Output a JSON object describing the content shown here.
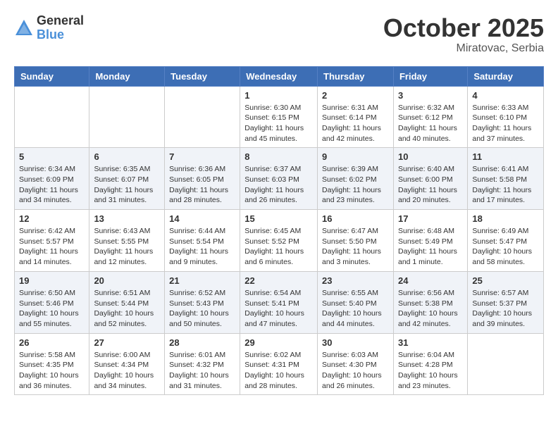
{
  "header": {
    "logo": {
      "general": "General",
      "blue": "Blue"
    },
    "title": "October 2025",
    "location": "Miratovac, Serbia"
  },
  "weekdays": [
    "Sunday",
    "Monday",
    "Tuesday",
    "Wednesday",
    "Thursday",
    "Friday",
    "Saturday"
  ],
  "weeks": [
    [
      {
        "day": "",
        "info": ""
      },
      {
        "day": "",
        "info": ""
      },
      {
        "day": "",
        "info": ""
      },
      {
        "day": "1",
        "info": "Sunrise: 6:30 AM\nSunset: 6:15 PM\nDaylight: 11 hours\nand 45 minutes."
      },
      {
        "day": "2",
        "info": "Sunrise: 6:31 AM\nSunset: 6:14 PM\nDaylight: 11 hours\nand 42 minutes."
      },
      {
        "day": "3",
        "info": "Sunrise: 6:32 AM\nSunset: 6:12 PM\nDaylight: 11 hours\nand 40 minutes."
      },
      {
        "day": "4",
        "info": "Sunrise: 6:33 AM\nSunset: 6:10 PM\nDaylight: 11 hours\nand 37 minutes."
      }
    ],
    [
      {
        "day": "5",
        "info": "Sunrise: 6:34 AM\nSunset: 6:09 PM\nDaylight: 11 hours\nand 34 minutes."
      },
      {
        "day": "6",
        "info": "Sunrise: 6:35 AM\nSunset: 6:07 PM\nDaylight: 11 hours\nand 31 minutes."
      },
      {
        "day": "7",
        "info": "Sunrise: 6:36 AM\nSunset: 6:05 PM\nDaylight: 11 hours\nand 28 minutes."
      },
      {
        "day": "8",
        "info": "Sunrise: 6:37 AM\nSunset: 6:03 PM\nDaylight: 11 hours\nand 26 minutes."
      },
      {
        "day": "9",
        "info": "Sunrise: 6:39 AM\nSunset: 6:02 PM\nDaylight: 11 hours\nand 23 minutes."
      },
      {
        "day": "10",
        "info": "Sunrise: 6:40 AM\nSunset: 6:00 PM\nDaylight: 11 hours\nand 20 minutes."
      },
      {
        "day": "11",
        "info": "Sunrise: 6:41 AM\nSunset: 5:58 PM\nDaylight: 11 hours\nand 17 minutes."
      }
    ],
    [
      {
        "day": "12",
        "info": "Sunrise: 6:42 AM\nSunset: 5:57 PM\nDaylight: 11 hours\nand 14 minutes."
      },
      {
        "day": "13",
        "info": "Sunrise: 6:43 AM\nSunset: 5:55 PM\nDaylight: 11 hours\nand 12 minutes."
      },
      {
        "day": "14",
        "info": "Sunrise: 6:44 AM\nSunset: 5:54 PM\nDaylight: 11 hours\nand 9 minutes."
      },
      {
        "day": "15",
        "info": "Sunrise: 6:45 AM\nSunset: 5:52 PM\nDaylight: 11 hours\nand 6 minutes."
      },
      {
        "day": "16",
        "info": "Sunrise: 6:47 AM\nSunset: 5:50 PM\nDaylight: 11 hours\nand 3 minutes."
      },
      {
        "day": "17",
        "info": "Sunrise: 6:48 AM\nSunset: 5:49 PM\nDaylight: 11 hours\nand 1 minute."
      },
      {
        "day": "18",
        "info": "Sunrise: 6:49 AM\nSunset: 5:47 PM\nDaylight: 10 hours\nand 58 minutes."
      }
    ],
    [
      {
        "day": "19",
        "info": "Sunrise: 6:50 AM\nSunset: 5:46 PM\nDaylight: 10 hours\nand 55 minutes."
      },
      {
        "day": "20",
        "info": "Sunrise: 6:51 AM\nSunset: 5:44 PM\nDaylight: 10 hours\nand 52 minutes."
      },
      {
        "day": "21",
        "info": "Sunrise: 6:52 AM\nSunset: 5:43 PM\nDaylight: 10 hours\nand 50 minutes."
      },
      {
        "day": "22",
        "info": "Sunrise: 6:54 AM\nSunset: 5:41 PM\nDaylight: 10 hours\nand 47 minutes."
      },
      {
        "day": "23",
        "info": "Sunrise: 6:55 AM\nSunset: 5:40 PM\nDaylight: 10 hours\nand 44 minutes."
      },
      {
        "day": "24",
        "info": "Sunrise: 6:56 AM\nSunset: 5:38 PM\nDaylight: 10 hours\nand 42 minutes."
      },
      {
        "day": "25",
        "info": "Sunrise: 6:57 AM\nSunset: 5:37 PM\nDaylight: 10 hours\nand 39 minutes."
      }
    ],
    [
      {
        "day": "26",
        "info": "Sunrise: 5:58 AM\nSunset: 4:35 PM\nDaylight: 10 hours\nand 36 minutes."
      },
      {
        "day": "27",
        "info": "Sunrise: 6:00 AM\nSunset: 4:34 PM\nDaylight: 10 hours\nand 34 minutes."
      },
      {
        "day": "28",
        "info": "Sunrise: 6:01 AM\nSunset: 4:32 PM\nDaylight: 10 hours\nand 31 minutes."
      },
      {
        "day": "29",
        "info": "Sunrise: 6:02 AM\nSunset: 4:31 PM\nDaylight: 10 hours\nand 28 minutes."
      },
      {
        "day": "30",
        "info": "Sunrise: 6:03 AM\nSunset: 4:30 PM\nDaylight: 10 hours\nand 26 minutes."
      },
      {
        "day": "31",
        "info": "Sunrise: 6:04 AM\nSunset: 4:28 PM\nDaylight: 10 hours\nand 23 minutes."
      },
      {
        "day": "",
        "info": ""
      }
    ]
  ]
}
